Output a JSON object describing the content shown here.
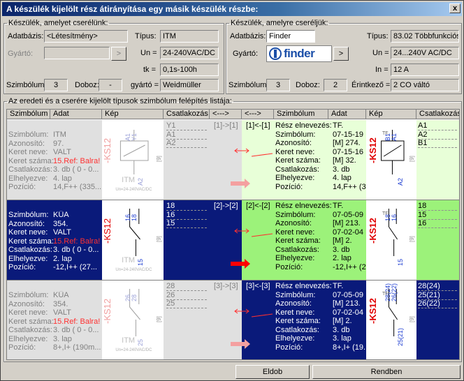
{
  "window": {
    "title": "A készülék kijelölt rész átirányítása egy másik készülék részbe:",
    "close": "x"
  },
  "left": {
    "legend": "Készülék, amelyet cserélünk:",
    "db_label": "Adatbázis:",
    "db_value": "<Létesítmény>",
    "maker_label": "Gyártó:",
    "maker_btn": ">",
    "type_label": "Típus:",
    "type_value": "ITM",
    "un_label": "Un =",
    "un_value": "24-240VAC/DC",
    "tk_label": "tk =",
    "tk_value": "0,1s-100h",
    "sym_label": "Szimbólum:",
    "sym_value": "3",
    "box_label": "Doboz:",
    "box_value": "-",
    "gy_label": "gyártó =",
    "gy_value": "Weidmüller"
  },
  "right": {
    "legend": "Készülék, amelyre cseréljük:",
    "db_label": "Adatbázis:",
    "db_value": "Finder",
    "maker_label": "Gyártó:",
    "maker_logo": "finder",
    "maker_btn": ">",
    "type_label": "Típus:",
    "type_value": "83.02 Többfunkciós",
    "un_label": "Un =",
    "un_value": "24...240V AC/DC",
    "in_label": "In =",
    "in_value": "12 A",
    "sym_label": "Szimbólum:",
    "sym_value": "3",
    "box_label": "Doboz:",
    "box_value": "2",
    "contact_label": "Érintkező =",
    "contact_value": "2 CO váltó"
  },
  "list": {
    "legend": "Az eredeti és a cserére kijelölt típusok szimbólum felépítés listája:",
    "headers": [
      "Szimbólum",
      "Adat",
      "Kép",
      "Csatlakozás",
      "<--->",
      "<--->",
      "Szimbólum",
      "Adat",
      "Kép",
      "Csatlakozás"
    ],
    "left_labels": [
      "Szimbólum:",
      "Azonosító:",
      "Keret neve:",
      "Keret száma:",
      "Csatlakozás:",
      "Elhelyezve:",
      "Pozíció:"
    ],
    "right_labels": [
      "Rész elnevezés:",
      "Szimbólum:",
      "Azonosító:",
      "Keret neve:",
      "Keret száma:",
      "Csatlakozás:",
      "Elhelyezve:",
      "Pozíció:"
    ],
    "rows": [
      {
        "l_values": [
          "ITM",
          "97.",
          "VALT",
          "15.Ref: Balra!",
          "3. db ( 0 - 0...",
          "4. lap",
          "14,F++ (335..."
        ],
        "l_conn": [
          "Y1",
          "A1",
          "A2"
        ],
        "map_l": "[1]->[1]",
        "map_r": "[1]<-[1]",
        "r_values": [
          "TF.",
          "07-15-19",
          "[M] 274.",
          "07-15-16",
          "[M] 32.",
          "3. db",
          "4. lap",
          "14,F++ (3..."
        ],
        "r_conn": [
          "A1",
          "A2",
          "B1"
        ],
        "pic_l": {
          "tag": "-KS12",
          "pins": [
            "A1",
            "Y1",
            "A2"
          ],
          "name": "ITM",
          "spec": "Un=24-240VAC/DC",
          "term": "[9]"
        },
        "pic_r": {
          "tag": "-KS12",
          "pins": [
            "B1",
            "A1",
            "A2"
          ],
          "name": "TF.",
          "term": "[9]"
        }
      },
      {
        "l_values": [
          "KÜA",
          "354.",
          "VALT",
          "15.Ref: Balra!",
          "3. db ( 0 - 0...",
          "2. lap",
          "-12,I++ (27..."
        ],
        "l_conn": [
          "18",
          "16",
          "15"
        ],
        "map_l": "[2]->[2]",
        "map_r": "[2]<-[2]",
        "r_values": [
          "TF.",
          "07-05-09",
          "[M] 213.",
          "07-02-04",
          "[M] 2.",
          "3. db",
          "2. lap",
          "-12,I++ (2..."
        ],
        "r_conn": [
          "18",
          "15",
          "16"
        ],
        "pic_l": {
          "tag": "-KS12",
          "pins": [
            "16",
            "18",
            "15"
          ],
          "name": "ITM",
          "spec": "Un=24-240VAC/DC",
          "term": "[9]"
        },
        "pic_r": {
          "tag": "-KS12",
          "pins": [
            "18",
            "16",
            "15"
          ],
          "name": "TF.",
          "term": "[9]"
        }
      },
      {
        "l_values": [
          "KÜA",
          "354.",
          "VALT",
          "15.Ref: Balra!",
          "3. db ( 0 - 0...",
          "3. lap",
          "8+,I+ (190m..."
        ],
        "l_conn": [
          "28",
          "26",
          "25"
        ],
        "map_l": "[3]->[3]",
        "map_r": "[3]<-[3]",
        "r_values": [
          "TF.",
          "07-05-09",
          "[M] 213.",
          "07-02-04",
          "[M] 2.",
          "3. db",
          "3. lap",
          "8+,I+ (19..."
        ],
        "r_conn": [
          "28(24)",
          "25(21)",
          "26(22)"
        ],
        "pic_l": {
          "tag": "-KS12",
          "pins": [
            "26",
            "28",
            "25"
          ],
          "name": "ITM",
          "spec": "Un=24-240VAC/DC",
          "term": "[9]"
        },
        "pic_r": {
          "tag": "-KS12",
          "pins": [
            "28(24)",
            "26(22)",
            "25(21)"
          ],
          "name": "TF.",
          "term": "[9]"
        }
      }
    ]
  },
  "buttons": {
    "back": "Eldob",
    "ok": "Rendben"
  },
  "colors": {
    "selected": "#0a1a7a",
    "green": "#9cf27a",
    "red": "#ff3030"
  }
}
